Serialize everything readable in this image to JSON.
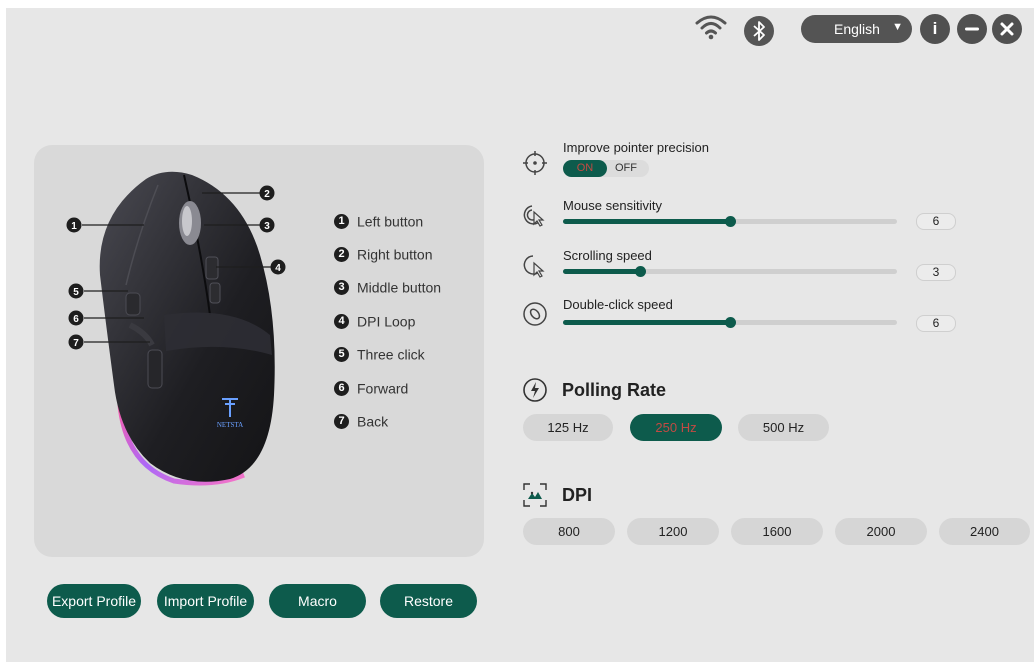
{
  "header": {
    "wifi_icon": "wifi-icon",
    "bluetooth_icon": "bluetooth-icon",
    "language": "English",
    "info_label": "i"
  },
  "mouse_panel": {
    "brand_text": "NETSTA",
    "legend": [
      {
        "num": "1",
        "label": "Left button"
      },
      {
        "num": "2",
        "label": "Right button"
      },
      {
        "num": "3",
        "label": "Middle button"
      },
      {
        "num": "4",
        "label": "DPI Loop"
      },
      {
        "num": "5",
        "label": "Three click"
      },
      {
        "num": "6",
        "label": "Forward"
      },
      {
        "num": "7",
        "label": "Back"
      }
    ]
  },
  "bottom_buttons": {
    "export": "Export Profile",
    "import": "Import Profile",
    "macro": "Macro",
    "restore": "Restore"
  },
  "settings": {
    "precision": {
      "label": "Improve pointer precision",
      "on": "ON",
      "off": "OFF",
      "enabled": true
    },
    "sensitivity": {
      "label": "Mouse sensitivity",
      "value": "6",
      "level": 0.5
    },
    "scrolling": {
      "label": "Scrolling speed",
      "value": "3",
      "level": 0.23
    },
    "double_click": {
      "label": "Double-click speed",
      "value": "6",
      "level": 0.5
    }
  },
  "polling": {
    "title": "Polling Rate",
    "options": [
      "125 Hz",
      "250 Hz",
      "500 Hz"
    ],
    "selected": "250 Hz"
  },
  "dpi": {
    "title": "DPI",
    "options": [
      "800",
      "1200",
      "1600",
      "2000",
      "2400"
    ]
  },
  "colors": {
    "accent": "#0d5b4c",
    "selected_text": "#c24a43",
    "background": "#e7e7e7"
  }
}
